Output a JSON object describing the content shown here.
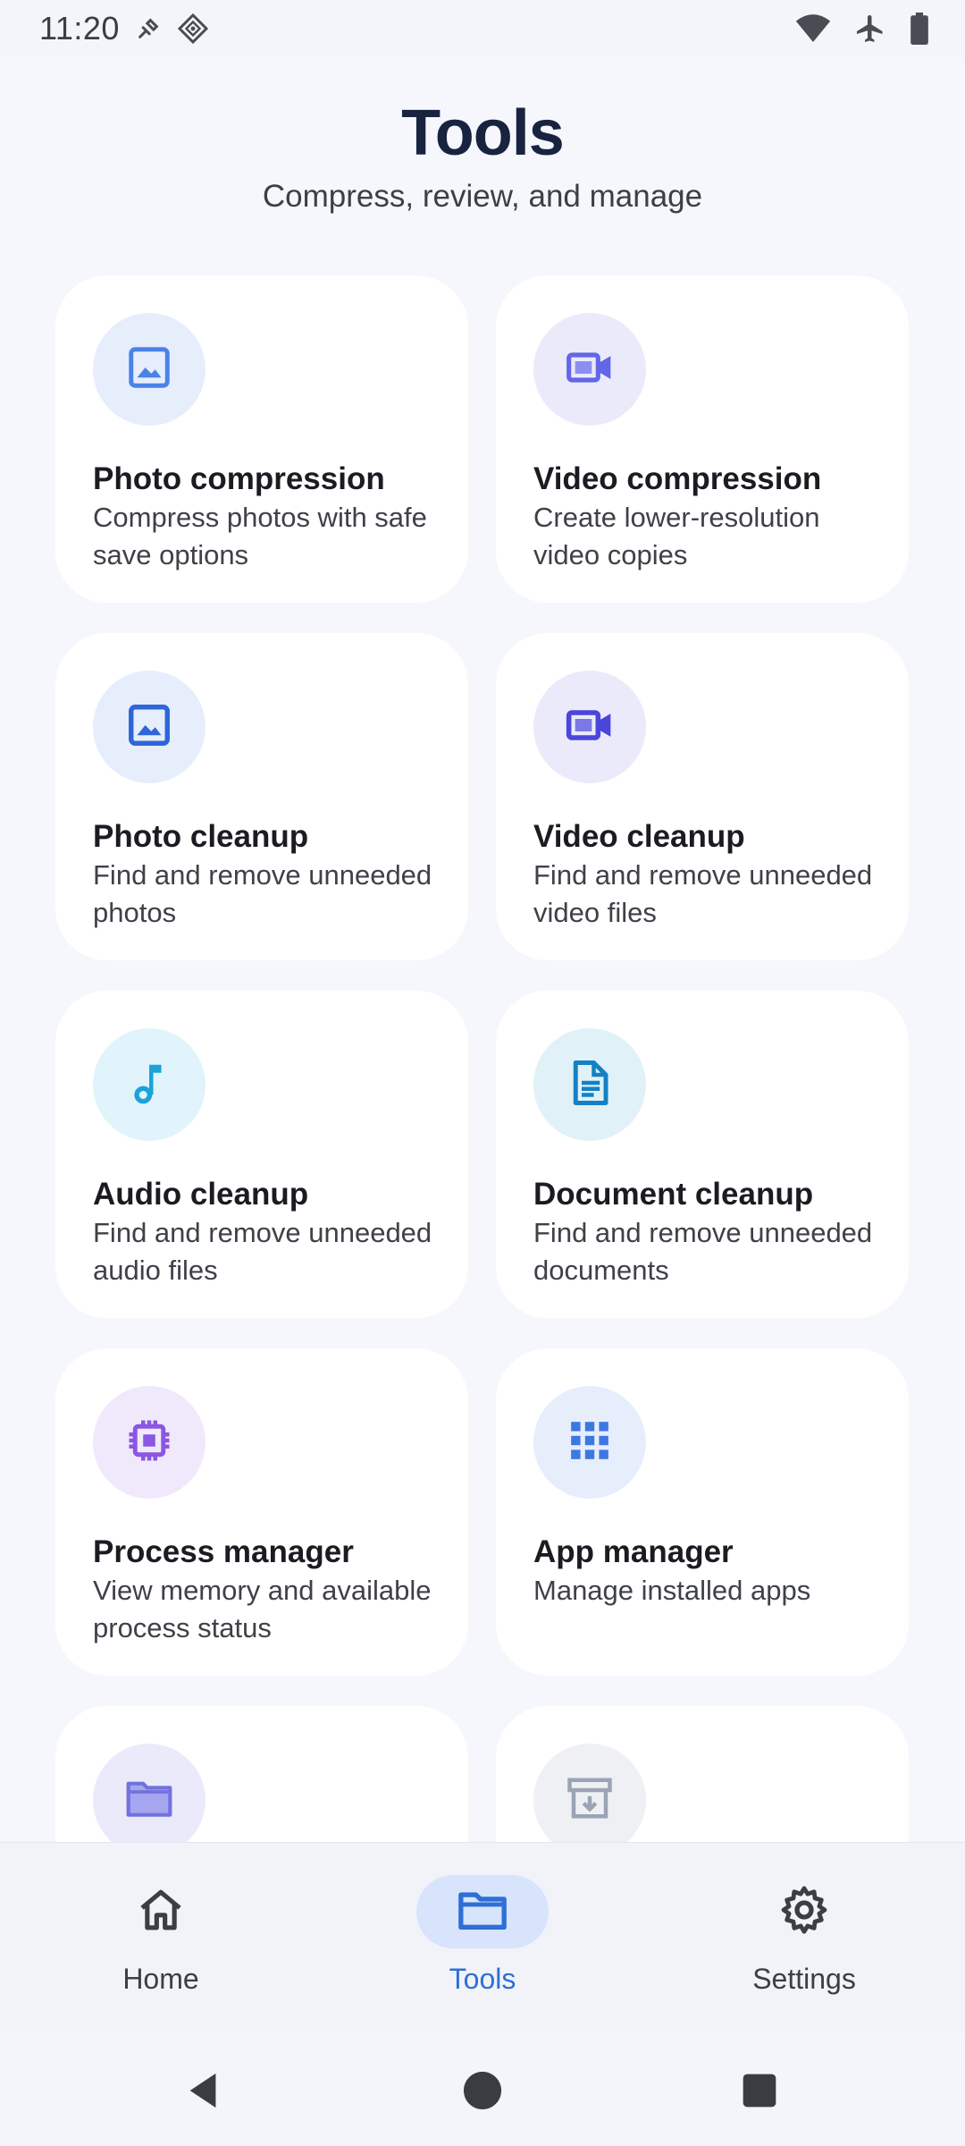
{
  "status_bar": {
    "time": "11:20",
    "icons_left": [
      "tools-notification-icon",
      "diamond-notification-icon"
    ],
    "icons_right": [
      "wifi-icon",
      "airplane-icon",
      "battery-icon"
    ]
  },
  "header": {
    "title": "Tools",
    "subtitle": "Compress, review, and manage"
  },
  "cards": [
    {
      "title": "Photo compression",
      "desc": "Compress photos with safe save options",
      "icon": "image-icon",
      "color": "#4a82e8",
      "bg": "#e6eefc"
    },
    {
      "title": "Video compression",
      "desc": "Create lower-resolution video copies",
      "icon": "video-camera-icon",
      "color": "#6366e6",
      "bg": "#ebeafb"
    },
    {
      "title": "Photo cleanup",
      "desc": "Find and remove unneeded photos",
      "icon": "image-icon",
      "color": "#2e65d8",
      "bg": "#e6eefc"
    },
    {
      "title": "Video cleanup",
      "desc": "Find and remove unneeded video files",
      "icon": "video-camera-icon",
      "color": "#4a45db",
      "bg": "#ebeafb"
    },
    {
      "title": "Audio cleanup",
      "desc": "Find and remove unneeded audio files",
      "icon": "music-note-icon",
      "color": "#1ba3d8",
      "bg": "#e1f4fb"
    },
    {
      "title": "Document cleanup",
      "desc": "Find and remove unneeded documents",
      "icon": "document-icon",
      "color": "#1481c4",
      "bg": "#e1f1f8"
    },
    {
      "title": "Process manager",
      "desc": "View memory and available process status",
      "icon": "chip-icon",
      "color": "#8a56e2",
      "bg": "#efe9fb"
    },
    {
      "title": "App manager",
      "desc": "Manage installed apps",
      "icon": "apps-grid-icon",
      "color": "#3d78e0",
      "bg": "#e6eefc"
    },
    {
      "title": "",
      "desc": "",
      "icon": "folder-icon",
      "color": "#7272de",
      "bg": "#ebeafb"
    },
    {
      "title": "",
      "desc": "",
      "icon": "archive-icon",
      "color": "#9aa4b5",
      "bg": "#eef0f4"
    }
  ],
  "bottom_nav": {
    "items": [
      {
        "label": "Home",
        "icon": "home-icon",
        "active": false
      },
      {
        "label": "Tools",
        "icon": "folder-icon",
        "active": true
      },
      {
        "label": "Settings",
        "icon": "gear-icon",
        "active": false
      }
    ],
    "active_color": "#2f6fd6"
  },
  "system_nav": [
    "back-icon",
    "home-circle-icon",
    "recents-icon"
  ]
}
